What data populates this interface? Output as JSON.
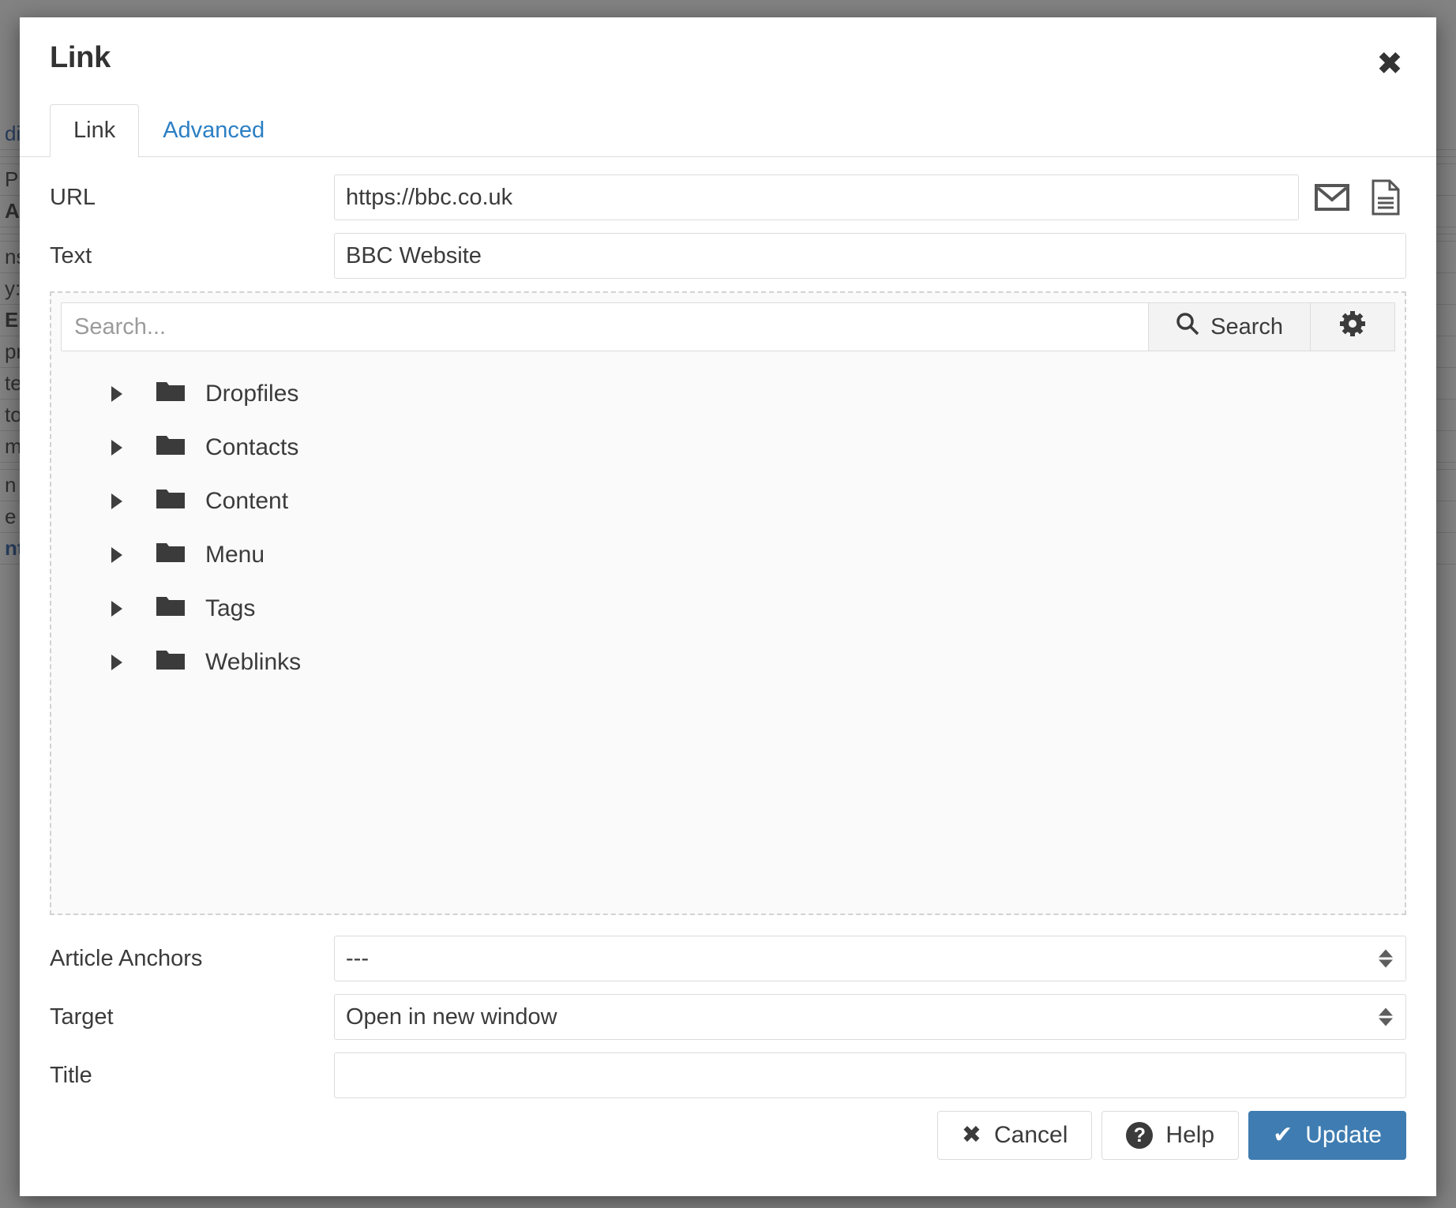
{
  "backdrop": {
    "lines": [
      "dit",
      "",
      "",
      "P",
      "A",
      "",
      "",
      "ns",
      "y:",
      "EH",
      "pr",
      "ter",
      "tor",
      "me",
      "",
      "n ",
      "e ",
      "nts"
    ]
  },
  "dialog": {
    "title": "Link",
    "close_icon": "close-icon"
  },
  "tabs": [
    {
      "label": "Link",
      "active": true
    },
    {
      "label": "Advanced",
      "active": false
    }
  ],
  "form": {
    "url": {
      "label": "URL",
      "value": "https://bbc.co.uk",
      "placeholder": "",
      "email_icon": "envelope-icon",
      "doc_icon": "document-icon"
    },
    "text": {
      "label": "Text",
      "value": "BBC Website",
      "placeholder": ""
    },
    "article_anchors": {
      "label": "Article Anchors",
      "value": "---",
      "options": [
        "---"
      ]
    },
    "target": {
      "label": "Target",
      "value": "Open in new window",
      "options": [
        "Open in new window"
      ]
    },
    "title_field": {
      "label": "Title",
      "value": "",
      "placeholder": ""
    }
  },
  "browser": {
    "search_placeholder": "Search...",
    "search_value": "",
    "search_button_label": "Search",
    "search_icon": "magnifier-icon",
    "settings_icon": "gear-icon",
    "tree": [
      {
        "label": "Dropfiles"
      },
      {
        "label": "Contacts"
      },
      {
        "label": "Content"
      },
      {
        "label": "Menu"
      },
      {
        "label": "Tags"
      },
      {
        "label": "Weblinks"
      }
    ]
  },
  "footer": {
    "cancel": {
      "label": "Cancel",
      "icon": "x-icon"
    },
    "help": {
      "label": "Help",
      "icon": "question-icon"
    },
    "update": {
      "label": "Update",
      "icon": "check-icon"
    }
  },
  "colors": {
    "primary": "#3e7cb1",
    "link": "#2b7fc4",
    "text": "#3b3b3b",
    "overlay": "#6e6e6e"
  }
}
